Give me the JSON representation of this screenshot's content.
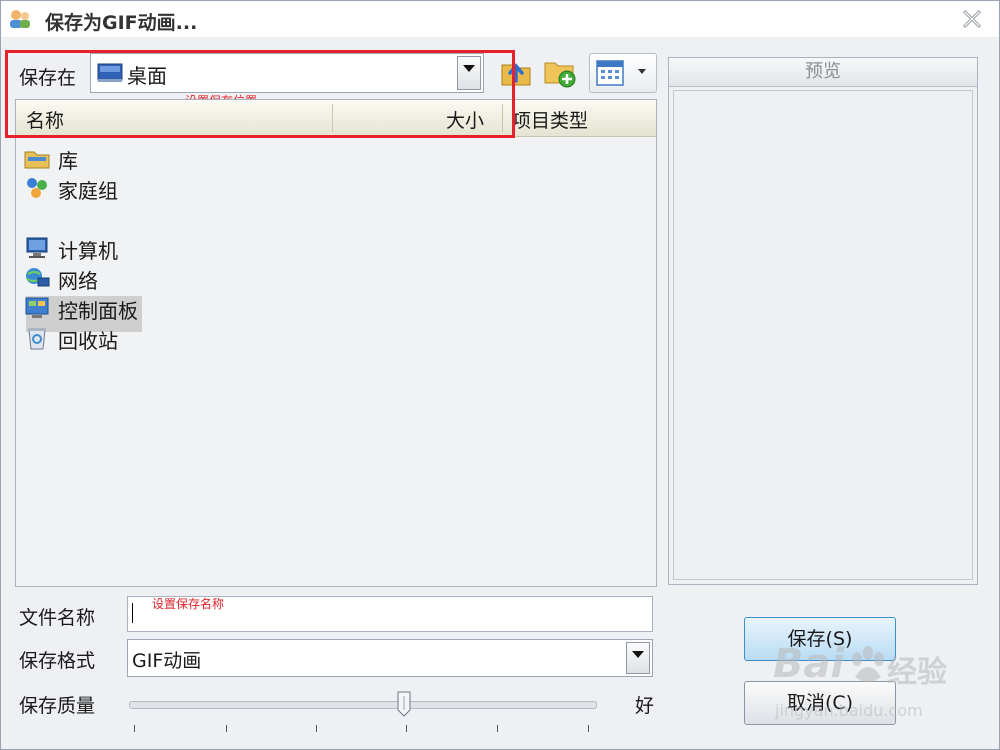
{
  "window": {
    "title": "保存为GIF动画..."
  },
  "location": {
    "label": "保存在",
    "value": "桌面",
    "hint": "设置保存位置"
  },
  "columns": {
    "name": "名称",
    "size": "大小",
    "type": "项目类型"
  },
  "items": [
    {
      "label": "库",
      "icon": "library-folder-icon"
    },
    {
      "label": "家庭组",
      "icon": "homegroup-icon"
    },
    {
      "label": "计算机",
      "icon": "computer-icon"
    },
    {
      "label": "网络",
      "icon": "network-icon"
    },
    {
      "label": "控制面板",
      "icon": "control-panel-icon"
    },
    {
      "label": "回收站",
      "icon": "recycle-bin-icon"
    }
  ],
  "preview": {
    "label": "预览"
  },
  "filename": {
    "label": "文件名称",
    "value": "",
    "hint": "设置保存名称"
  },
  "format": {
    "label": "保存格式",
    "value": "GIF动画"
  },
  "quality": {
    "label": "保存质量",
    "end_label": "好",
    "level": 0.59
  },
  "buttons": {
    "save": "保存(S)",
    "cancel": "取消(C)"
  },
  "watermark": {
    "brand": "Bai",
    "brand2": "经验",
    "url": "jingyan.baidu.com"
  },
  "colors": {
    "highlight": "#e6212b",
    "accent": "#3c8ecf"
  }
}
